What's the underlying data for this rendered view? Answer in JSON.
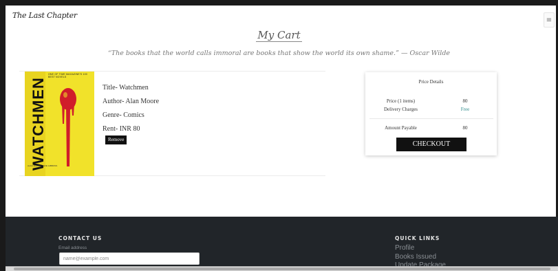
{
  "navbar": {
    "brand": "The Last Chapter",
    "menu_icon": "hamburger-icon",
    "menu_glyph": "≡"
  },
  "page": {
    "heading": "My Cart",
    "quote": "“The books that the world calls immoral are books that show the world its own shame.” — Oscar Wilde"
  },
  "cart_item": {
    "cover": {
      "title": "WATCHMEN",
      "tagline": "ONE OF TIME MAGAZINE'S 100 BEST NOVELS",
      "credits": "ALAN MOORE DAVE GIBBONS",
      "background_color": "#f1e22a"
    },
    "title": "Title- Watchmen",
    "author": "Author- Alan Moore",
    "genre": "Genre- Comics",
    "rent": "Rent- INR 80",
    "remove_label": "Remove"
  },
  "price_details": {
    "title": "Price Details",
    "rows": [
      {
        "label": "Price (1 items)",
        "value": "80"
      },
      {
        "label": "Delivery Charges",
        "value": "Free"
      }
    ],
    "total_label": "Amount Payable",
    "total_value": "80",
    "checkout_label": "CHECKOUT",
    "free_color": "#2e8b8b"
  },
  "footer": {
    "contact_title": "CONTACT US",
    "email_label": "Email address",
    "email_placeholder": "name@example.com",
    "quick_links_title": "QUICK LINKS",
    "quick_links": [
      "Profile",
      "Books Issued",
      "Update Package"
    ],
    "background_color": "#212529"
  }
}
